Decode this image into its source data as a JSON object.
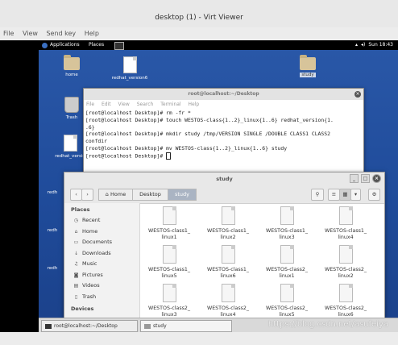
{
  "viewer": {
    "title": "desktop (1) - Virt Viewer",
    "menu": [
      "File",
      "View",
      "Send key",
      "Help"
    ]
  },
  "guest_topbar": {
    "applications": "Applications",
    "places": "Places",
    "time": "Sun 18:43"
  },
  "desktop_icons": {
    "home": "home",
    "redhat_version6": "redhat_version6",
    "study": "study",
    "trash": "Trash",
    "redhat_version_partial": "redhat_versio",
    "redhat_partial_1": "redh",
    "redhat_partial_2": "redh",
    "redhat_partial_3": "redh"
  },
  "terminal": {
    "title": "root@localhost:~/Desktop",
    "menu": [
      "File",
      "Edit",
      "View",
      "Search",
      "Terminal",
      "Help"
    ],
    "lines": [
      "[root@localhost Desktop]# rm -fr *",
      "[root@localhost Desktop]# touch WESTOS-class{1..2}_linux{1..6} redhat_version{1.",
      ".6}",
      "[root@localhost Desktop]# mkdir study /tmp/VERSION SINGLE /DOUBLE CLASS1 CLASS2",
      "confdir",
      "[root@localhost Desktop]# mv WESTOS-class{1..2}_linux{1..6} study",
      "[root@localhost Desktop]# "
    ]
  },
  "file_manager": {
    "title": "study",
    "breadcrumbs": [
      "Home",
      "Desktop",
      "study"
    ],
    "sidebar": {
      "places_header": "Places",
      "items": [
        "Recent",
        "Home",
        "Documents",
        "Downloads",
        "Music",
        "Pictures",
        "Videos",
        "Trash"
      ],
      "devices_header": "Devices"
    },
    "files": [
      {
        "line1": "WESTOS-class1_",
        "line2": "linux1"
      },
      {
        "line1": "WESTOS-class1_",
        "line2": "linux2"
      },
      {
        "line1": "WESTOS-class1_",
        "line2": "linux3"
      },
      {
        "line1": "WESTOS-class1_",
        "line2": "linux4"
      },
      {
        "line1": "WESTOS-class1_",
        "line2": "linux5"
      },
      {
        "line1": "WESTOS-class1_",
        "line2": "linux6"
      },
      {
        "line1": "WESTOS-class2_",
        "line2": "linux1"
      },
      {
        "line1": "WESTOS-class2_",
        "line2": "linux2"
      },
      {
        "line1": "WESTOS-class2_",
        "line2": "linux3"
      },
      {
        "line1": "WESTOS-class2_",
        "line2": "linux4"
      },
      {
        "line1": "WESTOS-class2_",
        "line2": "linux5"
      },
      {
        "line1": "WESTOS-class2_",
        "line2": "linux6"
      }
    ]
  },
  "taskbar": {
    "items": [
      "root@localhost:~/Desktop",
      "study"
    ]
  },
  "watermark": "https://blog.csdn.net/asufeiya"
}
